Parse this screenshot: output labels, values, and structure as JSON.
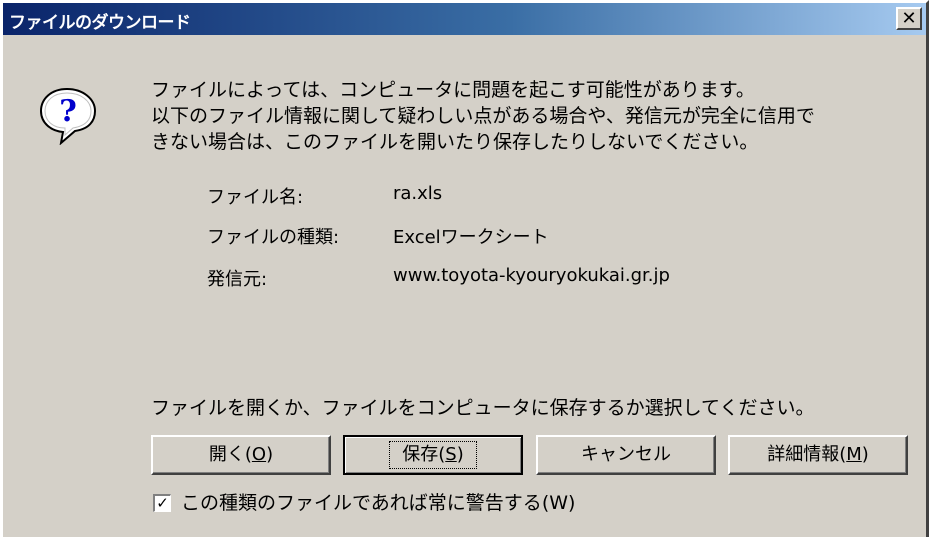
{
  "window": {
    "title": "ファイルのダウンロード",
    "close_glyph": "✕"
  },
  "warning": {
    "line1": "ファイルによっては、コンピュータに問題を起こす可能性があります。",
    "line2": "以下のファイル情報に関して疑わしい点がある場合や、発信元が完全に信用で",
    "line3": "きない場合は、このファイルを開いたり保存したりしないでください。"
  },
  "file_info": {
    "name_label": "ファイル名:",
    "name_value": "ra.xls",
    "type_label": "ファイルの種類:",
    "type_value": "Excelワークシート",
    "source_label": "発信元:",
    "source_value": "www.toyota-kyouryokukai.gr.jp"
  },
  "prompt": "ファイルを開くか、ファイルをコンピュータに保存するか選択してください。",
  "buttons": {
    "open": {
      "label": "開く(",
      "key": "O",
      "suffix": ")"
    },
    "save": {
      "label": "保存(",
      "key": "S",
      "suffix": ")"
    },
    "cancel": {
      "label": "キャンセル"
    },
    "details": {
      "label": "詳細情報(",
      "key": "M",
      "suffix": ")"
    }
  },
  "checkbox": {
    "checked": true,
    "mark": "✓",
    "label": "この種類のファイルであれば常に警告する",
    "key": "(W)"
  },
  "icons": {
    "question": "question-icon",
    "accent": "#0a246a"
  }
}
